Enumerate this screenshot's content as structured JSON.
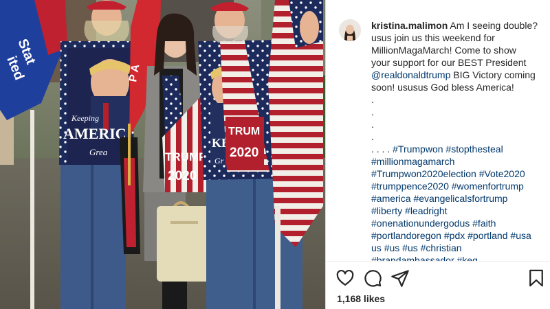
{
  "post": {
    "username": "kristina.malimon",
    "caption_lines": [
      [
        {
          "t": "Am I seeing double?",
          "k": "plain"
        }
      ],
      [
        {
          "t": "usus join us this weekend for",
          "k": "plain"
        }
      ],
      [
        {
          "t": "MillionMagaMarch! Come to show",
          "k": "plain"
        }
      ],
      [
        {
          "t": "your support for our BEST President",
          "k": "plain"
        }
      ],
      [
        {
          "t": "@realdonaldtrump",
          "k": "link"
        },
        {
          "t": " BIG Victory coming",
          "k": "plain"
        }
      ],
      [
        {
          "t": "soon! ususus God bless America!",
          "k": "plain"
        }
      ],
      [
        {
          "t": ".",
          "k": "plain"
        }
      ],
      [
        {
          "t": ".",
          "k": "plain"
        }
      ],
      [
        {
          "t": ".",
          "k": "plain"
        }
      ],
      [
        {
          "t": ".",
          "k": "plain"
        }
      ],
      [
        {
          "t": ". . . . ",
          "k": "plain"
        },
        {
          "t": "#Trumpwon",
          "k": "link"
        },
        {
          "t": " ",
          "k": "plain"
        },
        {
          "t": "#stopthesteal",
          "k": "link"
        }
      ],
      [
        {
          "t": "#millionmagamarch",
          "k": "link"
        }
      ],
      [
        {
          "t": "#Trumpwon2020election",
          "k": "link"
        },
        {
          "t": " ",
          "k": "plain"
        },
        {
          "t": "#Vote2020",
          "k": "link"
        }
      ],
      [
        {
          "t": "#trumppence2020",
          "k": "link"
        },
        {
          "t": " ",
          "k": "plain"
        },
        {
          "t": "#womenfortrump",
          "k": "link"
        }
      ],
      [
        {
          "t": "#america",
          "k": "link"
        },
        {
          "t": " ",
          "k": "plain"
        },
        {
          "t": "#evangelicalsfortrump",
          "k": "link"
        }
      ],
      [
        {
          "t": "#liberty",
          "k": "link"
        },
        {
          "t": " ",
          "k": "plain"
        },
        {
          "t": "#leadright",
          "k": "link"
        }
      ],
      [
        {
          "t": "#onenationundergodus",
          "k": "link"
        },
        {
          "t": " ",
          "k": "plain"
        },
        {
          "t": "#faith",
          "k": "link"
        }
      ],
      [
        {
          "t": "#portlandoregon",
          "k": "link"
        },
        {
          "t": " ",
          "k": "plain"
        },
        {
          "t": "#pdx",
          "k": "link"
        },
        {
          "t": " ",
          "k": "plain"
        },
        {
          "t": "#portland",
          "k": "link"
        },
        {
          "t": " ",
          "k": "plain"
        },
        {
          "t": "#usa",
          "k": "link"
        }
      ],
      [
        {
          "t": "us",
          "k": "link"
        },
        {
          "t": " ",
          "k": "plain"
        },
        {
          "t": "#us",
          "k": "link"
        },
        {
          "t": " ",
          "k": "plain"
        },
        {
          "t": "#us",
          "k": "link"
        },
        {
          "t": " ",
          "k": "plain"
        },
        {
          "t": "#christian",
          "k": "link"
        }
      ],
      [
        {
          "t": "#brandambassador #keg",
          "k": "link"
        }
      ]
    ],
    "likes_text": "1,168 likes"
  },
  "photo": {
    "shirt_text_1": "Keeping",
    "shirt_text_2": "AMERIC",
    "shirt_text_3": "Grea",
    "scarf_text_left_1": "TRUMP",
    "scarf_text_left_2": "2020",
    "scarf_text_right_1": "TRUM",
    "scarf_text_right_2": "2020",
    "flag_text_left_1": "ited",
    "flag_text_left_2": "Stat",
    "flag_text_red": "P A",
    "shirt2_text": "KEE",
    "shirt2_text_b": "Gr"
  },
  "icons": {
    "like": "heart-icon",
    "comment": "comment-bubble-icon",
    "share": "paper-plane-icon",
    "save": "bookmark-icon"
  },
  "colors": {
    "link": "#00376b",
    "text": "#262626",
    "divider": "#efefef"
  }
}
